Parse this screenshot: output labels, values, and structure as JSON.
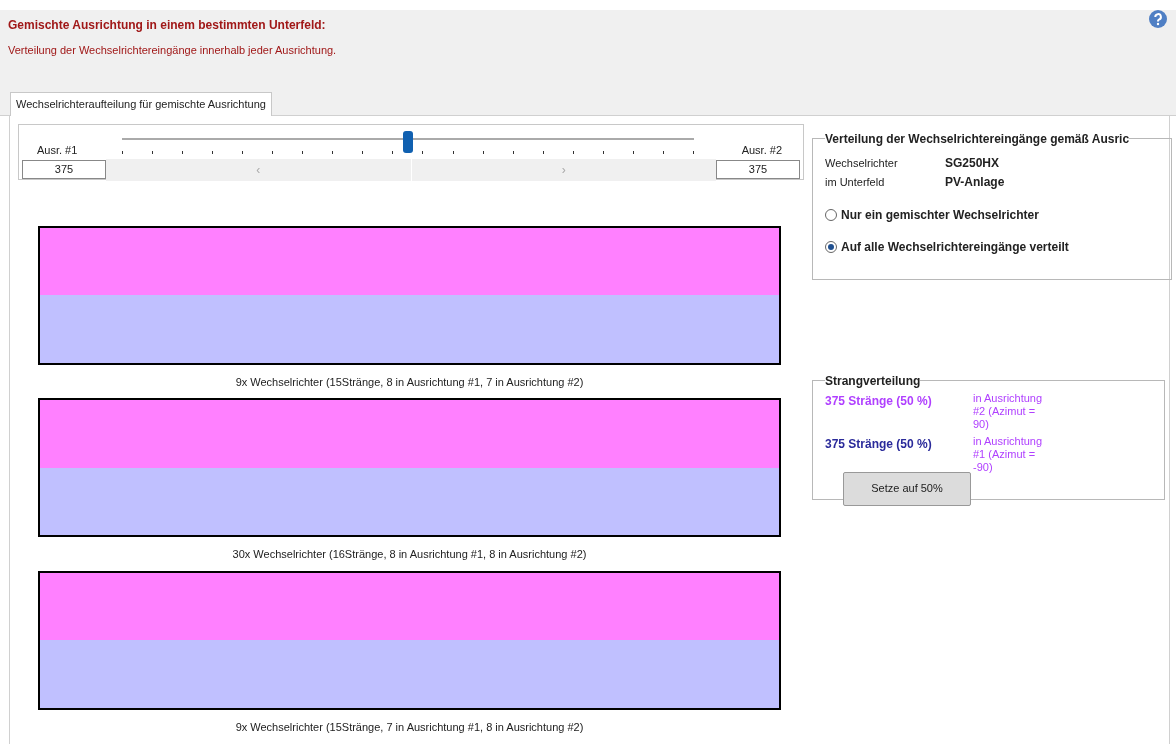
{
  "header": {
    "title": "Gemischte Ausrichtung in einem bestimmten Unterfeld:",
    "subtitle": "Verteilung der Wechselrichtereingänge innerhalb jeder Ausrichtung."
  },
  "tabs": [
    {
      "label": "Wechselrichteraufteilung für gemischte Ausrichtung",
      "selected": true
    }
  ],
  "slider": {
    "left_label": "Ausr. #1",
    "right_label": "Ausr. #2",
    "left_value": "375",
    "right_value": "375",
    "level": 0.5,
    "scroll_left": "‹",
    "scroll_right": "›"
  },
  "distribution_group": {
    "title": "Verteilung der Wechselrichtereingänge gemäß Ausric",
    "fields": [
      {
        "label": "Wechselrichter",
        "value": "SG250HX"
      },
      {
        "label": "im Unterfeld",
        "value": "PV-Anlage"
      }
    ],
    "options": [
      {
        "label": "Nur ein gemischter Wechselrichter",
        "selected": false
      },
      {
        "label": "Auf alle Wechselrichtereingänge verteilt",
        "selected": true
      }
    ]
  },
  "strings_group": {
    "title": "Strangverteilung",
    "rows": [
      {
        "count": "375 Stränge (50 %)",
        "detail": "in Ausrichtung #2 (Azimut = 90)",
        "color": "#b040ff"
      },
      {
        "count": "375 Stränge (50 %)",
        "detail": "in Ausrichtung #1 (Azimut = -90)",
        "color": "#2a2a9a"
      }
    ],
    "button": "Setze auf 50%"
  },
  "inverter_groups": [
    {
      "caption": "9x Wechselrichter (15Stränge, 8 in Ausrichtung #1, 7 in Ausrichtung #2)"
    },
    {
      "caption": "30x Wechselrichter (16Stränge, 8 in Ausrichtung #1, 8 in Ausrichtung #2)"
    },
    {
      "caption": "9x Wechselrichter (15Stränge, 7 in Ausrichtung #1, 8 in Ausrichtung #2)"
    }
  ]
}
